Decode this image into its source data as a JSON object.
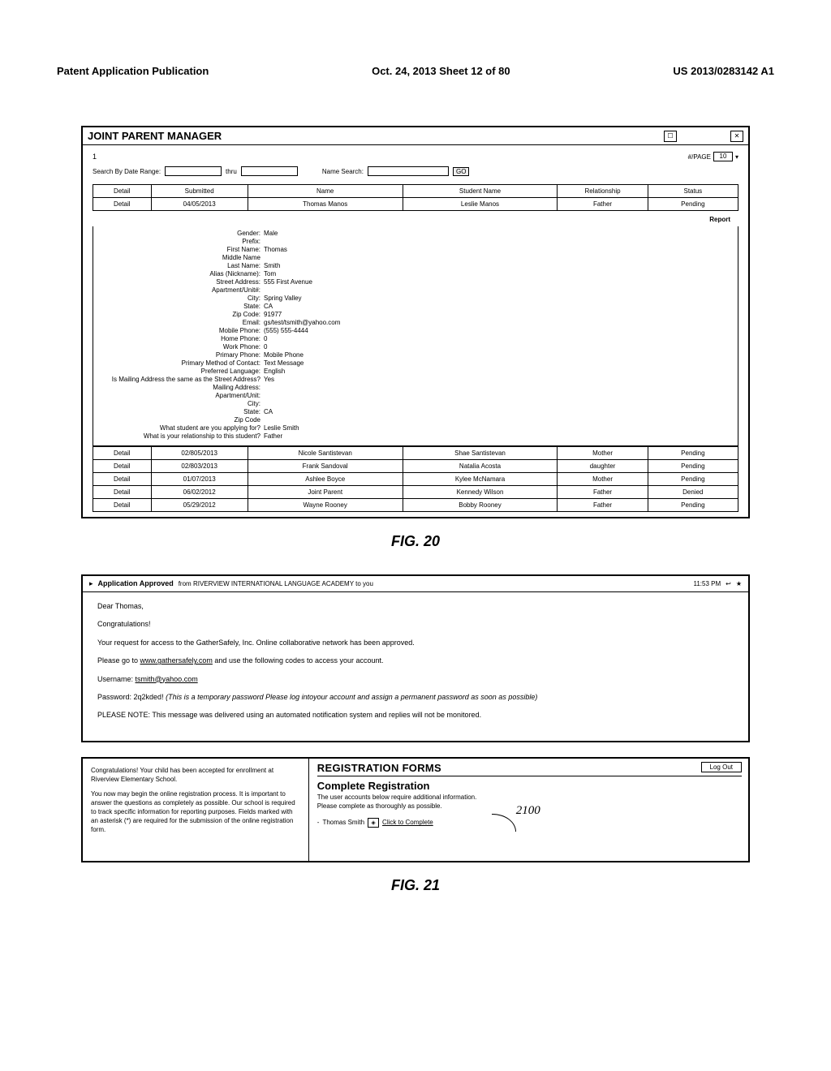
{
  "doc_header": {
    "left": "Patent Application Publication",
    "center": "Oct. 24, 2013  Sheet 12 of 80",
    "right": "US 2013/0283142 A1"
  },
  "fig20": {
    "panel_title": "JOINT PARENT MANAGER",
    "page_number": "1",
    "per_page_label": "#/PAGE",
    "per_page_value": "10",
    "search_by_date_label": "Search By Date Range:",
    "thru_label": "thru",
    "name_search_label": "Name Search:",
    "go_label": "GO",
    "headers": [
      "Detail",
      "Submitted",
      "Name",
      "Student Name",
      "Relationship",
      "Status"
    ],
    "row_primary": {
      "detail": "Detail",
      "submitted": "04/05/2013",
      "name": "Thomas Manos",
      "student": "Leslie Manos",
      "relationship": "Father",
      "status": "Pending"
    },
    "report_label": "Report",
    "details": [
      {
        "k": "Gender:",
        "v": "Male"
      },
      {
        "k": "Prefix:",
        "v": ""
      },
      {
        "k": "First Name:",
        "v": "Thomas"
      },
      {
        "k": "Middle Name",
        "v": ""
      },
      {
        "k": "Last Name:",
        "v": "Smith"
      },
      {
        "k": "Alias (Nickname):",
        "v": "Tom"
      },
      {
        "k": "Street Address:",
        "v": "555 First Avenue"
      },
      {
        "k": "Apartment/Unit#:",
        "v": ""
      },
      {
        "k": "City:",
        "v": "Spring Valley"
      },
      {
        "k": "State:",
        "v": "CA"
      },
      {
        "k": "Zip Code:",
        "v": "91977"
      },
      {
        "k": "Email:",
        "v": "gs/test/tsmith@yahoo.com"
      },
      {
        "k": "Mobile Phone:",
        "v": "(555) 555-4444"
      },
      {
        "k": "Home Phone:",
        "v": "0"
      },
      {
        "k": "Work Phone:",
        "v": "0"
      },
      {
        "k": "Primary Phone:",
        "v": "Mobile Phone"
      },
      {
        "k": "Primary Method of Contact:",
        "v": "Text Message"
      },
      {
        "k": "Preferred Language:",
        "v": "English"
      },
      {
        "k": "Is Mailing Address the same as the Street Address?",
        "v": "Yes"
      },
      {
        "k": "Mailing Address:",
        "v": ""
      },
      {
        "k": "Apartment/Unit:",
        "v": ""
      },
      {
        "k": "City:",
        "v": ""
      },
      {
        "k": "State:",
        "v": "CA"
      },
      {
        "k": "Zip Code",
        "v": ""
      },
      {
        "k": "What student are you applying for?",
        "v": "Leslie Smith"
      },
      {
        "k": "What is your relationship to this student?",
        "v": "Father"
      }
    ],
    "rows_after": [
      {
        "detail": "Detail",
        "submitted": "02/805/2013",
        "name": "Nicole Santistevan",
        "student": "Shae Santistevan",
        "relationship": "Mother",
        "status": "Pending"
      },
      {
        "detail": "Detail",
        "submitted": "02/803/2013",
        "name": "Frank Sandoval",
        "student": "Natalia Acosta",
        "relationship": "daughter",
        "status": "Pending"
      },
      {
        "detail": "Detail",
        "submitted": "01/07/2013",
        "name": "Ashlee Boyce",
        "student": "Kylee McNamara",
        "relationship": "Mother",
        "status": "Pending"
      },
      {
        "detail": "Detail",
        "submitted": "06/02/2012",
        "name": "Joint Parent",
        "student": "Kennedy Wilson",
        "relationship": "Father",
        "status": "Denied"
      },
      {
        "detail": "Detail",
        "submitted": "05/29/2012",
        "name": "Wayne Rooney",
        "student": "Bobby Rooney",
        "relationship": "Father",
        "status": "Pending"
      }
    ],
    "caption": "FIG. 20"
  },
  "fig21a": {
    "arrow": "▸",
    "subject": "Application Approved",
    "from_prefix": "from",
    "from": "RIVERVIEW INTERNATIONAL LANGUAGE ACADEMY",
    "from_suffix": "to you",
    "time": "11:53 PM",
    "reply_icon": "↩",
    "star_icon": "★",
    "greeting": "Dear Thomas,",
    "congrats": "Congratulations!",
    "line_approved": "Your request for access to the GatherSafely, Inc. Online collaborative network has been approved.",
    "line_goto_a": "Please go to ",
    "line_goto_link": "www.gathersafely.com",
    "line_goto_b": " and use the following codes to access your account.",
    "username_label": "Username: ",
    "username_value": "tsmith@yahoo.com",
    "password_label": "Password: ",
    "password_value": "2q2kded!",
    "password_note": "(This is a temporary password Please log intoyour account and assign a permanent password as soon as possible)",
    "please_note": "PLEASE NOTE: This message was delivered using an automated notification system and replies will not be monitored."
  },
  "fig21b": {
    "left_p1": "Congratulations! Your child has been accepted for enrollment at Riverview Elementary School.",
    "left_p2": "You now may begin the online registration process. It is important to answer the questions as completely as possible. Our school is required to track specific information for reporting purposes. Fields marked with an asterisk (*) are required for the submission of the online registration form.",
    "right_title": "REGISTRATION FORMS",
    "logout": "Log Out",
    "sub_title": "Complete Registration",
    "desc1": "The user accounts below require additional information.",
    "desc2": "Please complete as thoroughly as possible.",
    "annotation": "2100",
    "user_bullet": "-",
    "user_name": "Thomas Smith",
    "ctc_label": "Click to Complete",
    "ctc_icon_glyph": "◈"
  },
  "fig21_caption": "FIG. 21"
}
